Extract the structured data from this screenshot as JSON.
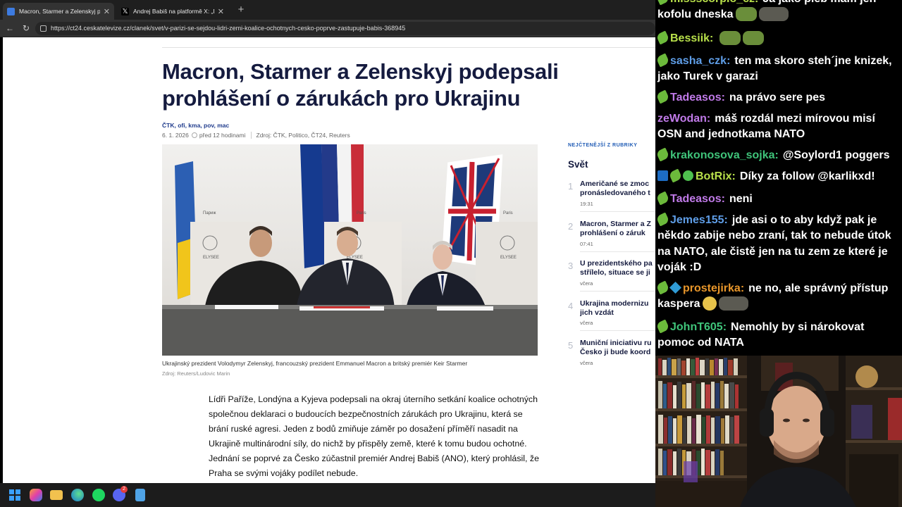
{
  "browser": {
    "tabs": [
      {
        "title": "Macron, Starmer a Zelenskyj pode",
        "active": true,
        "icon": "ct24-favicon"
      },
      {
        "title": "Andrej Babiš na platformě X: „Dne",
        "active": false,
        "icon": "x-favicon"
      }
    ],
    "new_tab": "+",
    "url": "https://ct24.ceskatelevize.cz/clanek/svet/v-parizi-se-sejdou-lidri-zemi-koalice-ochotnych-cesko-poprve-zastupuje-babis-368945"
  },
  "article": {
    "headline": "Macron, Starmer a Zelenskyj podepsali prohlášení o zárukách pro Ukrajinu",
    "authors": "ČTK, ofi, kma, pov, mac",
    "date": "6. 1. 2026",
    "relative_time": "před 12 hodinami",
    "source": "Zdroj: ČTK, Politico, ČT24, Reuters",
    "photo_caption": "Ukrajinský prezident Volodymyr Zelenskyj, francouzský prezident Emmanuel Macron a britský premiér Keir Starmer",
    "photo_credit": "Zdroj: Reuters/Ludovic Marin",
    "photo_signs": [
      "Париж",
      "Paris",
      "Paris"
    ],
    "podium_label": "ELYSEE",
    "body": "Lídři Paříže, Londýna a Kyjeva podepsali na okraj úterního setkání koalice ochotných společnou deklaraci o budoucích bezpečnostních zárukách pro Ukrajinu, která se brání ruské agresi. Jeden z bodů zmiňuje záměr po dosažení příměří nasadit na Ukrajině multinárodní síly, do nichž by přispěly země, které k tomu budou ochotné. Jednání se poprvé za Česko zúčastnil premiér Andrej Babiš (ANO), který prohlásil, že Praha se svými vojáky podílet nebude."
  },
  "sidebar": {
    "kicker": "NEJČTENĚJŠÍ Z RUBRIKY",
    "title": "Svět",
    "items": [
      {
        "num": "1",
        "headline": "Američané se zmoc\npronásledovaného t",
        "time": "19:31"
      },
      {
        "num": "2",
        "headline": "Macron, Starmer a Z\nprohlášení o záruk",
        "time": "07:41"
      },
      {
        "num": "3",
        "headline": "U prezidentského pa\nstřílelo, situace se ji",
        "time": "včera"
      },
      {
        "num": "4",
        "headline": "Ukrajina modernizu\njich vzdát",
        "time": "včera"
      },
      {
        "num": "5",
        "headline": "Muniční iniciativu ru\nČesko ji bude koord",
        "time": "včera"
      }
    ]
  },
  "taskbar": {
    "icons": [
      "windows-start-icon",
      "copilot-icon",
      "file-explorer-icon",
      "edge-browser-icon",
      "spotify-icon",
      "discord-icon",
      "notepad-icon"
    ],
    "discord_badge": "2"
  },
  "chat": {
    "messages": [
      {
        "badges": [
          "sub"
        ],
        "user": "missscorpio_cz:",
        "color": "#b8e04a",
        "text": "Ja jako pleb mam jen kofolu dneska",
        "emotes": [
          "frog",
          "gray"
        ]
      },
      {
        "badges": [
          "sub"
        ],
        "user": "Bessiik:",
        "color": "#b8e04a",
        "text": "",
        "emotes": [
          "frog",
          "frog"
        ]
      },
      {
        "badges": [
          "sub"
        ],
        "user": "sasha_czk:",
        "color": "#5f9ee8",
        "text": "ten ma skoro steh´jne knizek, jako Turek v garazi",
        "emotes": []
      },
      {
        "badges": [
          "sub"
        ],
        "user": "Tadeasos:",
        "color": "#c07ae8",
        "text": "na právo sere pes",
        "emotes": []
      },
      {
        "badges": [],
        "user": "zeWodan:",
        "color": "#c07ae8",
        "text": "máš rozdál mezi mírovou misí OSN and jednotkama NATO",
        "emotes": []
      },
      {
        "badges": [
          "sub"
        ],
        "user": "krakonosova_sojka:",
        "color": "#3fc47a",
        "text": "@Soylord1 poggers",
        "emotes": []
      },
      {
        "badges": [
          "bot",
          "sub",
          "ver"
        ],
        "user": "BotRix:",
        "color": "#b8e04a",
        "text": "Díky za follow @karlikxd!",
        "emotes": []
      },
      {
        "badges": [
          "sub"
        ],
        "user": "Tadeasos:",
        "color": "#c07ae8",
        "text": "neni",
        "emotes": []
      },
      {
        "badges": [
          "sub"
        ],
        "user": "Jemes155:",
        "color": "#5f9ee8",
        "text": "jde asi o to aby když pak je někdo zabije nebo zraní, tak to nebude útok na NATO, ale čistě jen na tu zem ze které je voják :D",
        "emotes": []
      },
      {
        "badges": [
          "sub",
          "box"
        ],
        "user": "prostejirka:",
        "color": "#e8962a",
        "text": "ne no, ale správný přístup kaspera",
        "emotes": [
          "face",
          "gray"
        ]
      },
      {
        "badges": [
          "sub"
        ],
        "user": "JohnT605:",
        "color": "#3fc47a",
        "text": "Nemohly by si nárokovat pomoc od NATA",
        "emotes": []
      }
    ]
  },
  "colors": {
    "headline": "#151b3f",
    "link": "#1f3b8c",
    "sub_badge": "#6cba3b"
  }
}
